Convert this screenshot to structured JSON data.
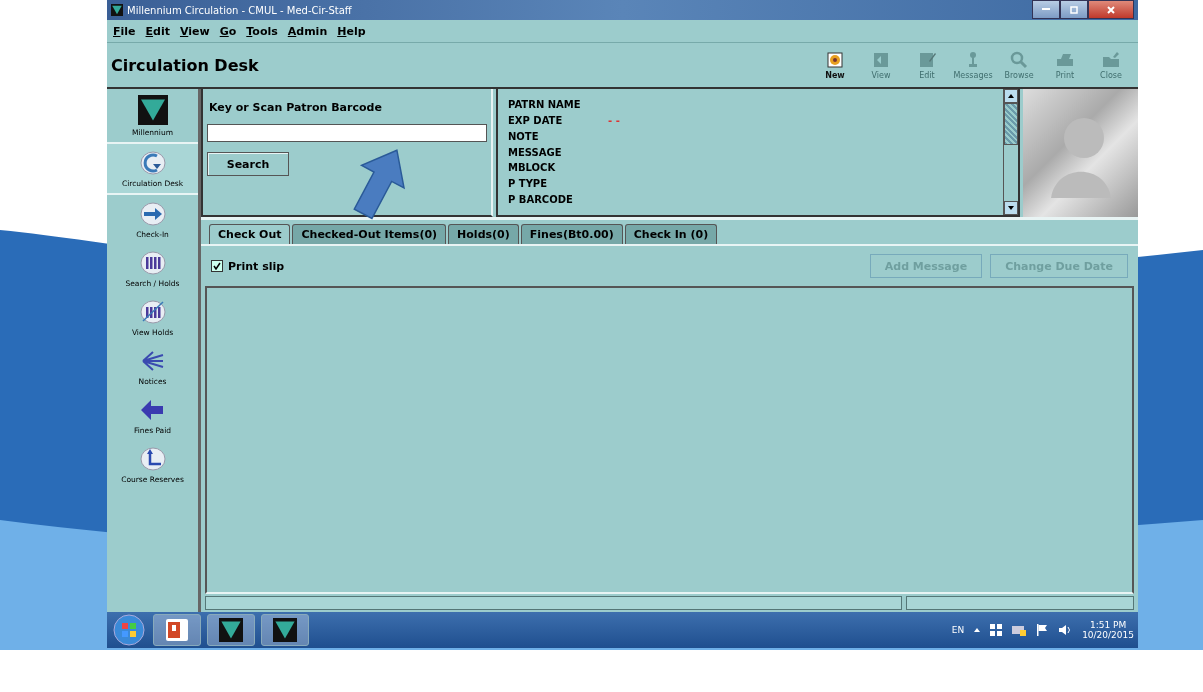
{
  "window": {
    "title": "Millennium Circulation - CMUL - Med-Cir-Staff"
  },
  "menu": [
    "File",
    "Edit",
    "View",
    "Go",
    "Tools",
    "Admin",
    "Help"
  ],
  "header": {
    "title": "Circulation Desk"
  },
  "toolbar": [
    {
      "kind": "new",
      "label": "New",
      "disabled": false
    },
    {
      "kind": "view",
      "label": "View",
      "disabled": true
    },
    {
      "kind": "edit",
      "label": "Edit",
      "disabled": true
    },
    {
      "kind": "messages",
      "label": "Messages",
      "disabled": true
    },
    {
      "kind": "browse",
      "label": "Browse",
      "disabled": true
    },
    {
      "kind": "print",
      "label": "Print",
      "disabled": true
    },
    {
      "kind": "close",
      "label": "Close",
      "disabled": true
    }
  ],
  "sidebar": {
    "items": [
      {
        "kind": "millennium",
        "label": "Millennium",
        "selected": false
      },
      {
        "kind": "circulation",
        "label": "Circulation Desk",
        "selected": true
      },
      {
        "kind": "checkin",
        "label": "Check-In",
        "selected": false
      },
      {
        "kind": "search",
        "label": "Search / Holds",
        "selected": false
      },
      {
        "kind": "viewholds",
        "label": "View Holds",
        "selected": false
      },
      {
        "kind": "notices",
        "label": "Notices",
        "selected": false
      },
      {
        "kind": "fines",
        "label": "Fines Paid",
        "selected": false
      },
      {
        "kind": "reserves",
        "label": "Course Reserves",
        "selected": false
      }
    ]
  },
  "search_panel": {
    "label": "Key or Scan Patron Barcode",
    "button": "Search"
  },
  "patron": {
    "fields": [
      {
        "label": "PATRN NAME"
      },
      {
        "label": "EXP DATE",
        "value": "- -"
      },
      {
        "label": "NOTE"
      },
      {
        "label": "MESSAGE"
      },
      {
        "label": "MBLOCK"
      },
      {
        "label": "P TYPE"
      },
      {
        "label": "P BARCODE"
      }
    ]
  },
  "tabs": [
    {
      "label": "Check Out",
      "selected": true
    },
    {
      "label": "Checked-Out Items(0)",
      "selected": false
    },
    {
      "label": "Holds(0)",
      "selected": false
    },
    {
      "label": "Fines(Bt0.00)",
      "selected": false
    },
    {
      "label": "Check In (0)",
      "selected": false
    }
  ],
  "checkout": {
    "print_slip": {
      "label": "Print slip",
      "checked": true
    },
    "buttons": [
      {
        "label": "Add Message",
        "disabled": true
      },
      {
        "label": "Change Due Date",
        "disabled": true
      }
    ]
  },
  "taskbar": {
    "apps": [
      {
        "kind": "powerpoint"
      },
      {
        "kind": "millennium"
      },
      {
        "kind": "millennium"
      }
    ],
    "language": "EN",
    "time": "1:51 PM",
    "date": "10/20/2015"
  }
}
